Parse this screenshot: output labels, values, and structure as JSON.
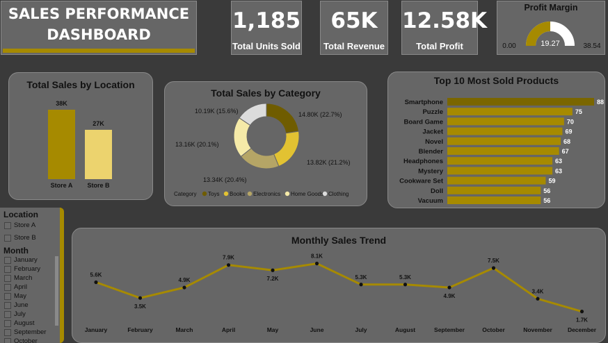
{
  "title": {
    "line1": "SALES PERFORMANCE",
    "line2": "DASHBOARD"
  },
  "kpis": [
    {
      "value": "1,185",
      "label": "Total Units Sold"
    },
    {
      "value": "65K",
      "label": "Total Revenue"
    },
    {
      "value": "12.58K",
      "label": "Total Profit"
    }
  ],
  "gauge": {
    "title": "Profit Margin",
    "value": "19.27",
    "min": "0.00",
    "max": "38.54",
    "fraction": 0.5,
    "fill_color": "#a68a00",
    "track_color": "#ffffff"
  },
  "colors": {
    "gold_dark": "#a68a00",
    "gold_light": "#ecd36e",
    "line": "#a68a00"
  },
  "slicer": {
    "location_title": "Location",
    "locations": [
      "Store A",
      "Store B"
    ],
    "month_title": "Month",
    "months": [
      "January",
      "February",
      "March",
      "April",
      "May",
      "June",
      "July",
      "August",
      "September",
      "October"
    ]
  },
  "chart_data": [
    {
      "type": "bar",
      "title": "Total Sales by Location",
      "categories": [
        "Store A",
        "Store B"
      ],
      "values": [
        38,
        27
      ],
      "data_labels": [
        "38K",
        "27K"
      ],
      "colors": [
        "#a68a00",
        "#ecd36e"
      ]
    },
    {
      "type": "pie",
      "title": "Total Sales by Category",
      "legend_title": "Category",
      "legend_position": "bottom",
      "slices": [
        {
          "name": "Toys",
          "value": 14.8,
          "label": "14.80K (22.7%)",
          "color": "#6f5c00"
        },
        {
          "name": "Books",
          "value": 13.82,
          "label": "13.82K (21.2%)",
          "color": "#e2c232"
        },
        {
          "name": "Electronics",
          "value": 13.34,
          "label": "13.34K (20.4%)",
          "color": "#b5a566"
        },
        {
          "name": "Home Goods",
          "value": 13.16,
          "label": "13.16K (20.1%)",
          "color": "#f5eaa8"
        },
        {
          "name": "Clothing",
          "value": 10.19,
          "label": "10.19K (15.6%)",
          "color": "#dcdcdc"
        }
      ]
    },
    {
      "type": "bar",
      "orientation": "horizontal",
      "title": "Top 10 Most Sold Products",
      "categories": [
        "Smartphone",
        "Puzzle",
        "Board Game",
        "Jacket",
        "Novel",
        "Blender",
        "Headphones",
        "Mystery",
        "Cookware Set",
        "Doll",
        "Vacuum"
      ],
      "values": [
        88,
        75,
        70,
        69,
        68,
        67,
        63,
        63,
        59,
        56,
        56
      ],
      "xlim": [
        0,
        88
      ]
    },
    {
      "type": "line",
      "title": "Monthly Sales Trend",
      "categories": [
        "January",
        "February",
        "March",
        "April",
        "May",
        "June",
        "July",
        "August",
        "September",
        "October",
        "November",
        "December"
      ],
      "values": [
        5.6,
        3.5,
        4.9,
        7.9,
        7.2,
        8.1,
        5.3,
        5.3,
        4.9,
        7.5,
        3.4,
        1.7
      ],
      "data_labels": [
        "5.6K",
        "3.5K",
        "4.9K",
        "7.9K",
        "7.2K",
        "8.1K",
        "5.3K",
        "5.3K",
        "4.9K",
        "7.5K",
        "3.4K",
        "1.7K"
      ]
    }
  ]
}
